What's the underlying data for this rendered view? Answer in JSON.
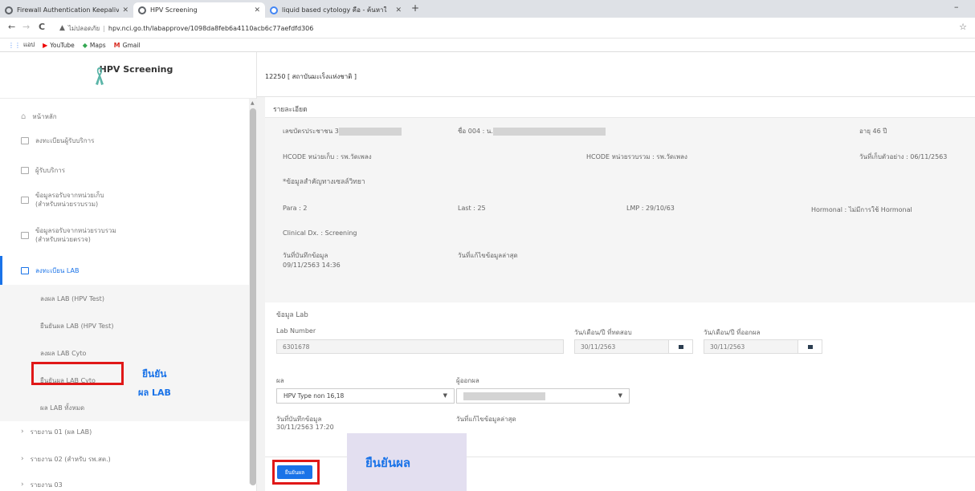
{
  "browser": {
    "tabs": [
      {
        "label": "Firewall Authentication Keepaliv",
        "favicon_color": "#5f6368"
      },
      {
        "label": "HPV Screening",
        "favicon_color": "#5f6368"
      },
      {
        "label": "liquid based cytology คือ - ค้นหาใ",
        "favicon_color": "#4285f4"
      }
    ],
    "new_tab": "+",
    "minimize": "–",
    "back": "←",
    "forward": "→",
    "reload": "C",
    "not_secure": "ไม่ปลอดภัย",
    "url": "hpv.nci.go.th/labapprove/1098da8feb6a4110acb6c77aefdfd306",
    "bookmarks": [
      "แอป",
      "YouTube",
      "Maps",
      "Gmail"
    ]
  },
  "app": {
    "brand": "HPV Screening",
    "hospital": "12250 [ สถาบันมะเร็งแห่งชาติ ]"
  },
  "menu": {
    "home": "หน้าหลัก",
    "register_client": "ลงทะเบียนผู้รับบริการ",
    "clients": "ผู้รับบริการ",
    "recv_collect": [
      "ข้อมูลรอรับจากหน่วยเก็บ",
      "(สำหรับหน่วยรวบรวม)"
    ],
    "recv_gather": [
      "ข้อมูลรอรับจากหน่วยรวบรวม",
      "(สำหรับหน่วยตรวจ)"
    ],
    "register_lab": "ลงทะเบียน LAB",
    "sub_items": [
      "ลงผล LAB (HPV Test)",
      "ยืนยันผล LAB (HPV Test)",
      "ลงผล LAB Cyto",
      "ยืนยันผล LAB Cyto",
      "ผล LAB ทั้งหมด"
    ],
    "report1": "รายงาน 01 (ผล LAB)",
    "report2": "รายงาน 02 (สำหรับ รพ.สต.)",
    "report3": "รายงาน 03"
  },
  "detail": {
    "header": "รายละเอียด",
    "id_label": "เลขบัตรประชาชน 3",
    "name_label": "ชื่อ 004 : น.",
    "age": "อายุ 46 ปี",
    "hcode_collect": "HCODE หน่วยเก็บ : รพ.วัดเพลง",
    "hcode_gather": "HCODE หน่วยรวบรวม : รพ.วัดเพลง",
    "collect_date": "วันที่เก็บตัวอย่าง : 06/11/2563",
    "cyto_heading": "*ข้อมูลสำคัญทางเซลล์วิทยา",
    "para": "Para : 2",
    "last": "Last : 25",
    "lmp": "LMP : 29/10/63",
    "hormonal": "Hormonal : ไม่มีการใช้ Hormonal",
    "clinical": "Clinical Dx. : Screening",
    "saved_label": "วันที่บันทึกข้อมูล",
    "saved_value": "09/11/2563 14:36",
    "edited_label": "วันที่แก้ไขข้อมูลล่าสุด"
  },
  "lab": {
    "heading": "ข้อมูล Lab",
    "lab_number_label": "Lab Number",
    "lab_number": "6301678",
    "test_date_label": "วัน/เดือน/ปี ที่ทดสอบ",
    "test_date": "30/11/2563",
    "result_date_label": "วัน/เดือน/ปี ที่ออกผล",
    "result_date": "30/11/2563",
    "result_label": "ผล",
    "result_value": "HPV Type non 16,18",
    "reporter_label": "ผู้ออกผล",
    "saved_label": "วันที่บันทึกข้อมูล",
    "saved_value": "30/11/2563 17:20",
    "edited_label": "วันที่แก้ไขข้อมูลล่าสุด",
    "confirm_button": "ยืนยันผล"
  },
  "annotations": {
    "side_line1": "ยืนยัน",
    "side_line2": "ผล LAB",
    "bottom": "ยืนยันผล",
    "highlight_color": "#e01818",
    "text_color": "#1a73e8"
  }
}
